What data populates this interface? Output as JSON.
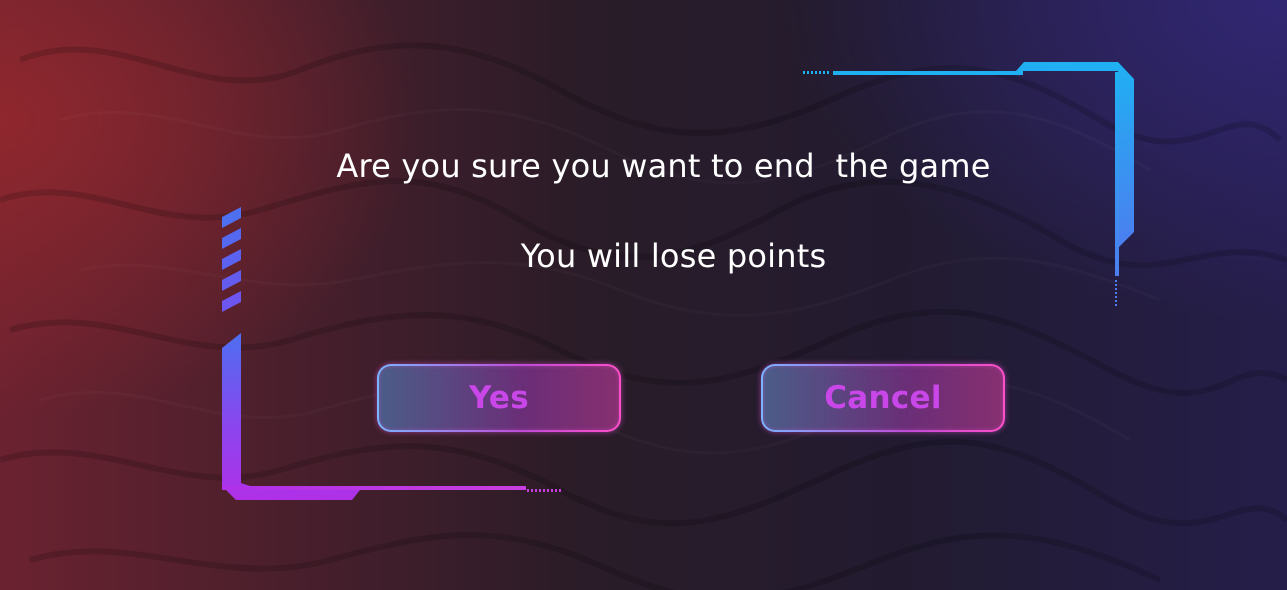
{
  "dialog": {
    "question": "Are you sure you want to end  the game",
    "warning": "You will lose points",
    "yes_label": "Yes",
    "cancel_label": "Cancel"
  },
  "colors": {
    "button_text": "#c946e8",
    "frame_top_right": "#1fb0f2",
    "frame_bottom_left": "#b030e8"
  }
}
